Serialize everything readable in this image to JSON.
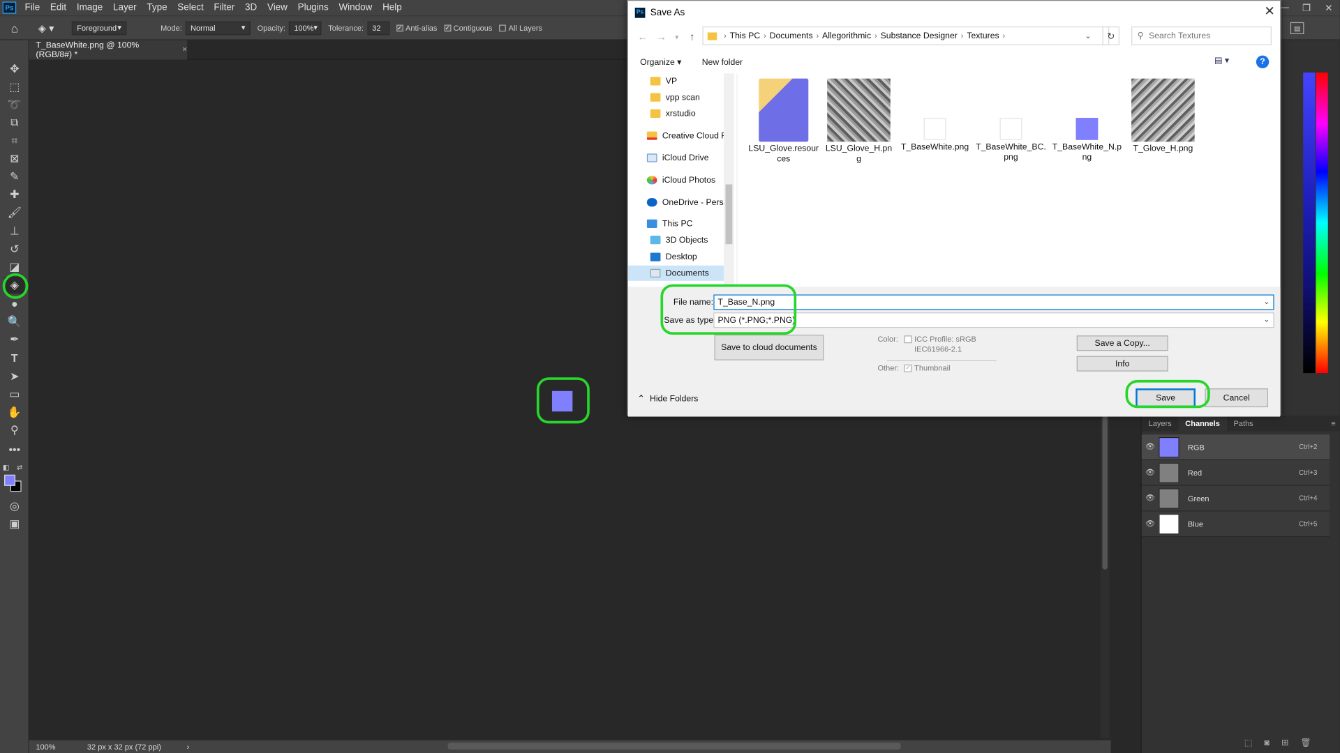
{
  "menu": [
    "File",
    "Edit",
    "Image",
    "Layer",
    "Type",
    "Select",
    "Filter",
    "3D",
    "View",
    "Plugins",
    "Window",
    "Help"
  ],
  "ps_logo": "Ps",
  "options_bar": {
    "fill_source": "Foreground",
    "mode_label": "Mode:",
    "mode_value": "Normal",
    "opacity_label": "Opacity:",
    "opacity_value": "100%",
    "tolerance_label": "Tolerance:",
    "tolerance_value": "32",
    "anti_alias": "Anti-alias",
    "contiguous": "Contiguous",
    "all_layers": "All Layers"
  },
  "document_tab": {
    "title": "T_BaseWhite.png @ 100% (RGB/8#) *",
    "close": "×"
  },
  "status_bar": {
    "zoom": "100%",
    "doc_info": "32 px x 32 px (72 ppi)"
  },
  "foreground_color": "#8080ff",
  "background_color": "#000000",
  "highlight_color": "#27d62a",
  "channels_panel": {
    "tabs": [
      "Layers",
      "Channels",
      "Paths"
    ],
    "active_tab": "Channels",
    "channels": [
      {
        "name": "RGB",
        "shortcut": "Ctrl+2",
        "thumb": "#8080ff"
      },
      {
        "name": "Red",
        "shortcut": "Ctrl+3",
        "thumb": "#808080"
      },
      {
        "name": "Green",
        "shortcut": "Ctrl+4",
        "thumb": "#808080"
      },
      {
        "name": "Blue",
        "shortcut": "Ctrl+5",
        "thumb": "#ffffff"
      }
    ]
  },
  "dialog": {
    "title": "Save As",
    "title_icon": "Ps",
    "breadcrumb": [
      "This PC",
      "Documents",
      "Allegorithmic",
      "Substance Designer",
      "Textures"
    ],
    "search_placeholder": "Search Textures",
    "organize": "Organize ▾",
    "new_folder": "New folder",
    "help": "?",
    "nav_items": [
      {
        "label": "VP",
        "icon": "folder"
      },
      {
        "label": "vpp scan",
        "icon": "folder"
      },
      {
        "label": "xrstudio",
        "icon": "folder"
      },
      {
        "label": "Creative Cloud Fil",
        "icon": "creative-cloud"
      },
      {
        "label": "iCloud Drive",
        "icon": "icloud"
      },
      {
        "label": "iCloud Photos",
        "icon": "icloud-photos"
      },
      {
        "label": "OneDrive - Persor",
        "icon": "onedrive"
      },
      {
        "label": "This PC",
        "icon": "pc"
      },
      {
        "label": "3D Objects",
        "icon": "3d-objects"
      },
      {
        "label": "Desktop",
        "icon": "desktop"
      },
      {
        "label": "Documents",
        "icon": "documents"
      }
    ],
    "files": [
      {
        "name": "LSU_Glove.resour ces",
        "kind": "folder"
      },
      {
        "name": "LSU_Glove_H.pn g",
        "kind": "height"
      },
      {
        "name": "T_BaseWhite.png",
        "kind": "white"
      },
      {
        "name": "T_BaseWhite_BC. png",
        "kind": "white"
      },
      {
        "name": "T_BaseWhite_N.p ng",
        "kind": "normal"
      },
      {
        "name": "T_Glove_H.png",
        "kind": "height"
      }
    ],
    "file_name_label": "File name:",
    "file_name_value": "T_Base_N.png",
    "save_type_label": "Save as type:",
    "save_type_value": "PNG (*.PNG;*.PNG)",
    "save_cloud": "Save to cloud documents",
    "color_label": "Color:",
    "icc_profile": "ICC Profile:  sRGB",
    "icc_profile_2": "IEC61966-2.1",
    "other_label": "Other:",
    "thumbnail": "Thumbnail",
    "save_copy": "Save a Copy...",
    "info": "Info",
    "hide_folders": "Hide Folders",
    "save": "Save",
    "cancel": "Cancel",
    "close": "✕"
  }
}
